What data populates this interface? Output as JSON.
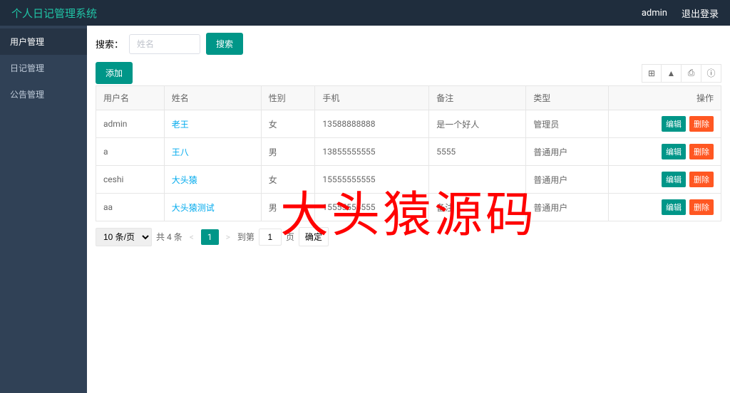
{
  "header": {
    "title": "个人日记管理系统",
    "user": "admin",
    "logout": "退出登录"
  },
  "sidebar": {
    "items": [
      {
        "label": "用户管理"
      },
      {
        "label": "日记管理"
      },
      {
        "label": "公告管理"
      }
    ]
  },
  "search": {
    "label": "搜索：",
    "placeholder": "姓名",
    "button": "搜索"
  },
  "toolbar": {
    "add": "添加"
  },
  "table": {
    "headers": {
      "username": "用户名",
      "name": "姓名",
      "gender": "性别",
      "phone": "手机",
      "remark": "备注",
      "type": "类型",
      "ops": "操作"
    },
    "rows": [
      {
        "username": "admin",
        "name": "老王",
        "gender": "女",
        "phone": "13588888888",
        "remark": "是一个好人",
        "type": "管理员"
      },
      {
        "username": "a",
        "name": "王八",
        "gender": "男",
        "phone": "13855555555",
        "remark": "5555",
        "type": "普通用户"
      },
      {
        "username": "ceshi",
        "name": "大头猿",
        "gender": "女",
        "phone": "15555555555",
        "remark": "",
        "type": "普通用户"
      },
      {
        "username": "aa",
        "name": "大头猿测试",
        "gender": "男",
        "phone": "15555555555",
        "remark": "备注",
        "type": "普通用户"
      }
    ],
    "ops": {
      "edit": "编辑",
      "del": "删除"
    }
  },
  "pagination": {
    "per_page": "10 条/页",
    "total": "共 4 条",
    "current": "1",
    "goto_label": "到第",
    "goto_value": "1",
    "page_label": "页",
    "confirm": "确定"
  },
  "watermark": "大头猿源码"
}
